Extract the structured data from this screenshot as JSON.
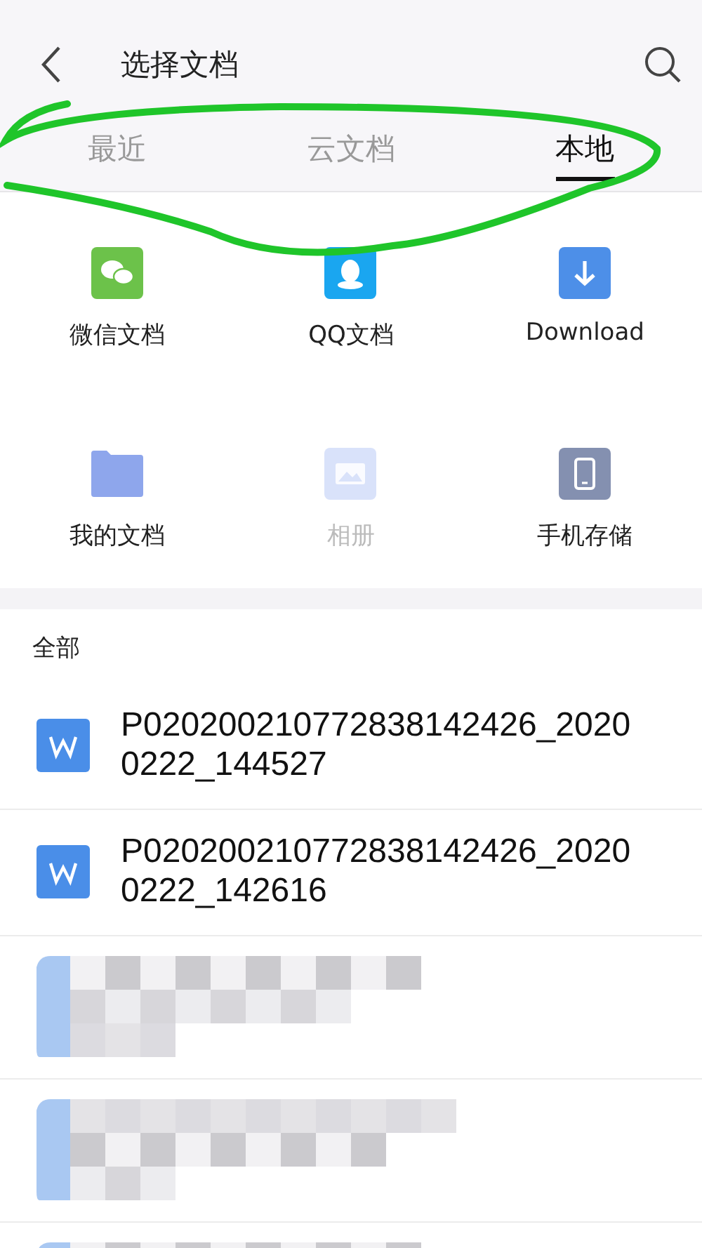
{
  "header": {
    "title": "选择文档"
  },
  "tabs": [
    {
      "label": "最近",
      "selected": false
    },
    {
      "label": "云文档",
      "selected": false
    },
    {
      "label": "本地",
      "selected": true
    }
  ],
  "shortcuts": [
    {
      "label": "微信文档",
      "kind": "chat",
      "disabled": false
    },
    {
      "label": "QQ文档",
      "kind": "figure",
      "disabled": false
    },
    {
      "label": "Download",
      "kind": "download",
      "disabled": false
    },
    {
      "label": "我的文档",
      "kind": "folder",
      "disabled": false
    },
    {
      "label": "相册",
      "kind": "image",
      "disabled": true
    },
    {
      "label": "手机存储",
      "kind": "phone",
      "disabled": false
    }
  ],
  "section_title": "全部",
  "files": [
    {
      "kind": "document",
      "name": "P020200210772838142426_20200222_144527"
    },
    {
      "kind": "document",
      "name": "P020200210772838142426_20200222_142616"
    },
    {
      "kind": "blurred"
    },
    {
      "kind": "blurred"
    },
    {
      "kind": "blurred"
    }
  ],
  "annotation": {
    "kind": "freehand-loop"
  }
}
